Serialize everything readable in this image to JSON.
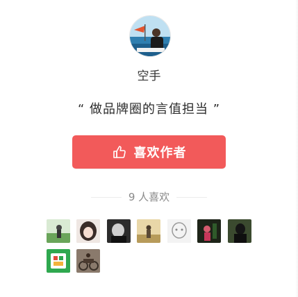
{
  "author": {
    "name": "空手",
    "quote": "“ 做品牌圈的言值担当 ”"
  },
  "like_button": {
    "label": "喜欢作者",
    "icon": "thumbs-up-icon",
    "bg_color": "#f25a5a"
  },
  "likes": {
    "count_text": "9 人喜欢",
    "likers": [
      {
        "id": "liker-1",
        "icon": "avatar-image"
      },
      {
        "id": "liker-2",
        "icon": "avatar-image"
      },
      {
        "id": "liker-3",
        "icon": "avatar-image"
      },
      {
        "id": "liker-4",
        "icon": "avatar-image"
      },
      {
        "id": "liker-5",
        "icon": "avatar-image"
      },
      {
        "id": "liker-6",
        "icon": "avatar-image"
      },
      {
        "id": "liker-7",
        "icon": "avatar-image"
      },
      {
        "id": "liker-8",
        "icon": "avatar-image"
      },
      {
        "id": "liker-9",
        "icon": "avatar-image"
      }
    ]
  }
}
